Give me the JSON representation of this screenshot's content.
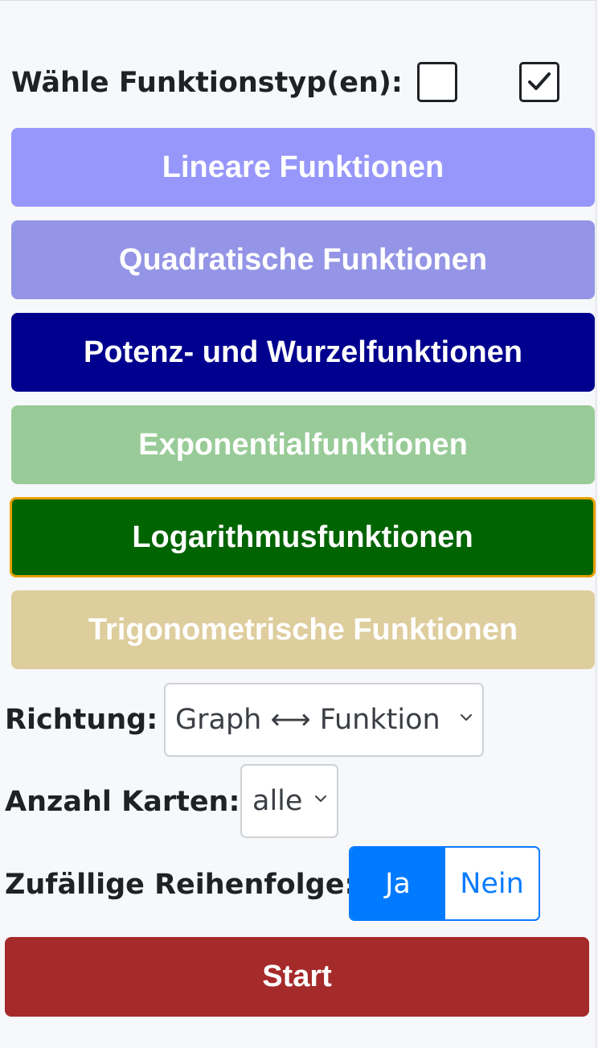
{
  "type_selection": {
    "label": "Wähle Funktionstyp(en):",
    "checkbox_none_icon": "empty-checkbox-icon",
    "checkbox_all_icon": "checked-checkbox-icon"
  },
  "function_buttons": [
    {
      "label": "Lineare Funktionen",
      "color": "#9797fb",
      "selected": false
    },
    {
      "label": "Quadratische Funktionen",
      "color": "#9495e6",
      "selected": false
    },
    {
      "label": "Potenz- und Wurzelfunktionen",
      "color": "#00008e",
      "selected": true
    },
    {
      "label": "Exponentialfunktionen",
      "color": "#98cb98",
      "selected": false
    },
    {
      "label": "Logarithmusfunktionen",
      "color": "#006400",
      "selected": true,
      "focused": true
    },
    {
      "label": "Trigonometrische Funktionen",
      "color": "#decd9d",
      "selected": false
    }
  ],
  "options": {
    "direction": {
      "label": "Richtung:",
      "value": "Graph ⟷ Funktion"
    },
    "card_count": {
      "label": "Anzahl Karten:",
      "value": "alle"
    },
    "random_order": {
      "label": "Zufällige Reihenfolge:",
      "yes": "Ja",
      "no": "Nein",
      "selected": "Ja"
    }
  },
  "start_button": {
    "label": "Start",
    "color": "#a52a2a"
  },
  "colors": {
    "background": "#f7f8fa",
    "text": "#1f2225",
    "toggle_accent": "#007bff",
    "focus_outline": "#e8a000"
  }
}
